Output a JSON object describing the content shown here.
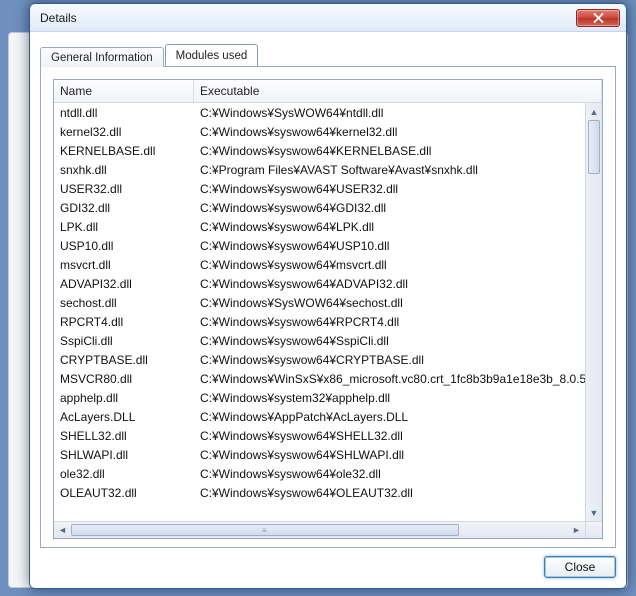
{
  "window": {
    "title": "Details",
    "close_button_name": "close-icon"
  },
  "tabs": [
    {
      "label": "General Information",
      "active": false
    },
    {
      "label": "Modules used",
      "active": true
    }
  ],
  "columns": {
    "name": "Name",
    "exec": "Executable"
  },
  "modules": [
    {
      "name": "ntdll.dll",
      "exec": "C:¥Windows¥SysWOW64¥ntdll.dll"
    },
    {
      "name": "kernel32.dll",
      "exec": "C:¥Windows¥syswow64¥kernel32.dll"
    },
    {
      "name": "KERNELBASE.dll",
      "exec": "C:¥Windows¥syswow64¥KERNELBASE.dll"
    },
    {
      "name": "snxhk.dll",
      "exec": "C:¥Program Files¥AVAST Software¥Avast¥snxhk.dll"
    },
    {
      "name": "USER32.dll",
      "exec": "C:¥Windows¥syswow64¥USER32.dll"
    },
    {
      "name": "GDI32.dll",
      "exec": "C:¥Windows¥syswow64¥GDI32.dll"
    },
    {
      "name": "LPK.dll",
      "exec": "C:¥Windows¥syswow64¥LPK.dll"
    },
    {
      "name": "USP10.dll",
      "exec": "C:¥Windows¥syswow64¥USP10.dll"
    },
    {
      "name": "msvcrt.dll",
      "exec": "C:¥Windows¥syswow64¥msvcrt.dll"
    },
    {
      "name": "ADVAPI32.dll",
      "exec": "C:¥Windows¥syswow64¥ADVAPI32.dll"
    },
    {
      "name": "sechost.dll",
      "exec": "C:¥Windows¥SysWOW64¥sechost.dll"
    },
    {
      "name": "RPCRT4.dll",
      "exec": "C:¥Windows¥syswow64¥RPCRT4.dll"
    },
    {
      "name": "SspiCli.dll",
      "exec": "C:¥Windows¥syswow64¥SspiCli.dll"
    },
    {
      "name": "CRYPTBASE.dll",
      "exec": "C:¥Windows¥syswow64¥CRYPTBASE.dll"
    },
    {
      "name": "MSVCR80.dll",
      "exec": "C:¥Windows¥WinSxS¥x86_microsoft.vc80.crt_1fc8b3b9a1e18e3b_8.0.5"
    },
    {
      "name": "apphelp.dll",
      "exec": "C:¥Windows¥system32¥apphelp.dll"
    },
    {
      "name": "AcLayers.DLL",
      "exec": "C:¥Windows¥AppPatch¥AcLayers.DLL"
    },
    {
      "name": "SHELL32.dll",
      "exec": "C:¥Windows¥syswow64¥SHELL32.dll"
    },
    {
      "name": "SHLWAPI.dll",
      "exec": "C:¥Windows¥syswow64¥SHLWAPI.dll"
    },
    {
      "name": "ole32.dll",
      "exec": "C:¥Windows¥syswow64¥ole32.dll"
    },
    {
      "name": "OLEAUT32.dll",
      "exec": "C:¥Windows¥syswow64¥OLEAUT32.dll"
    }
  ],
  "buttons": {
    "close": "Close"
  }
}
